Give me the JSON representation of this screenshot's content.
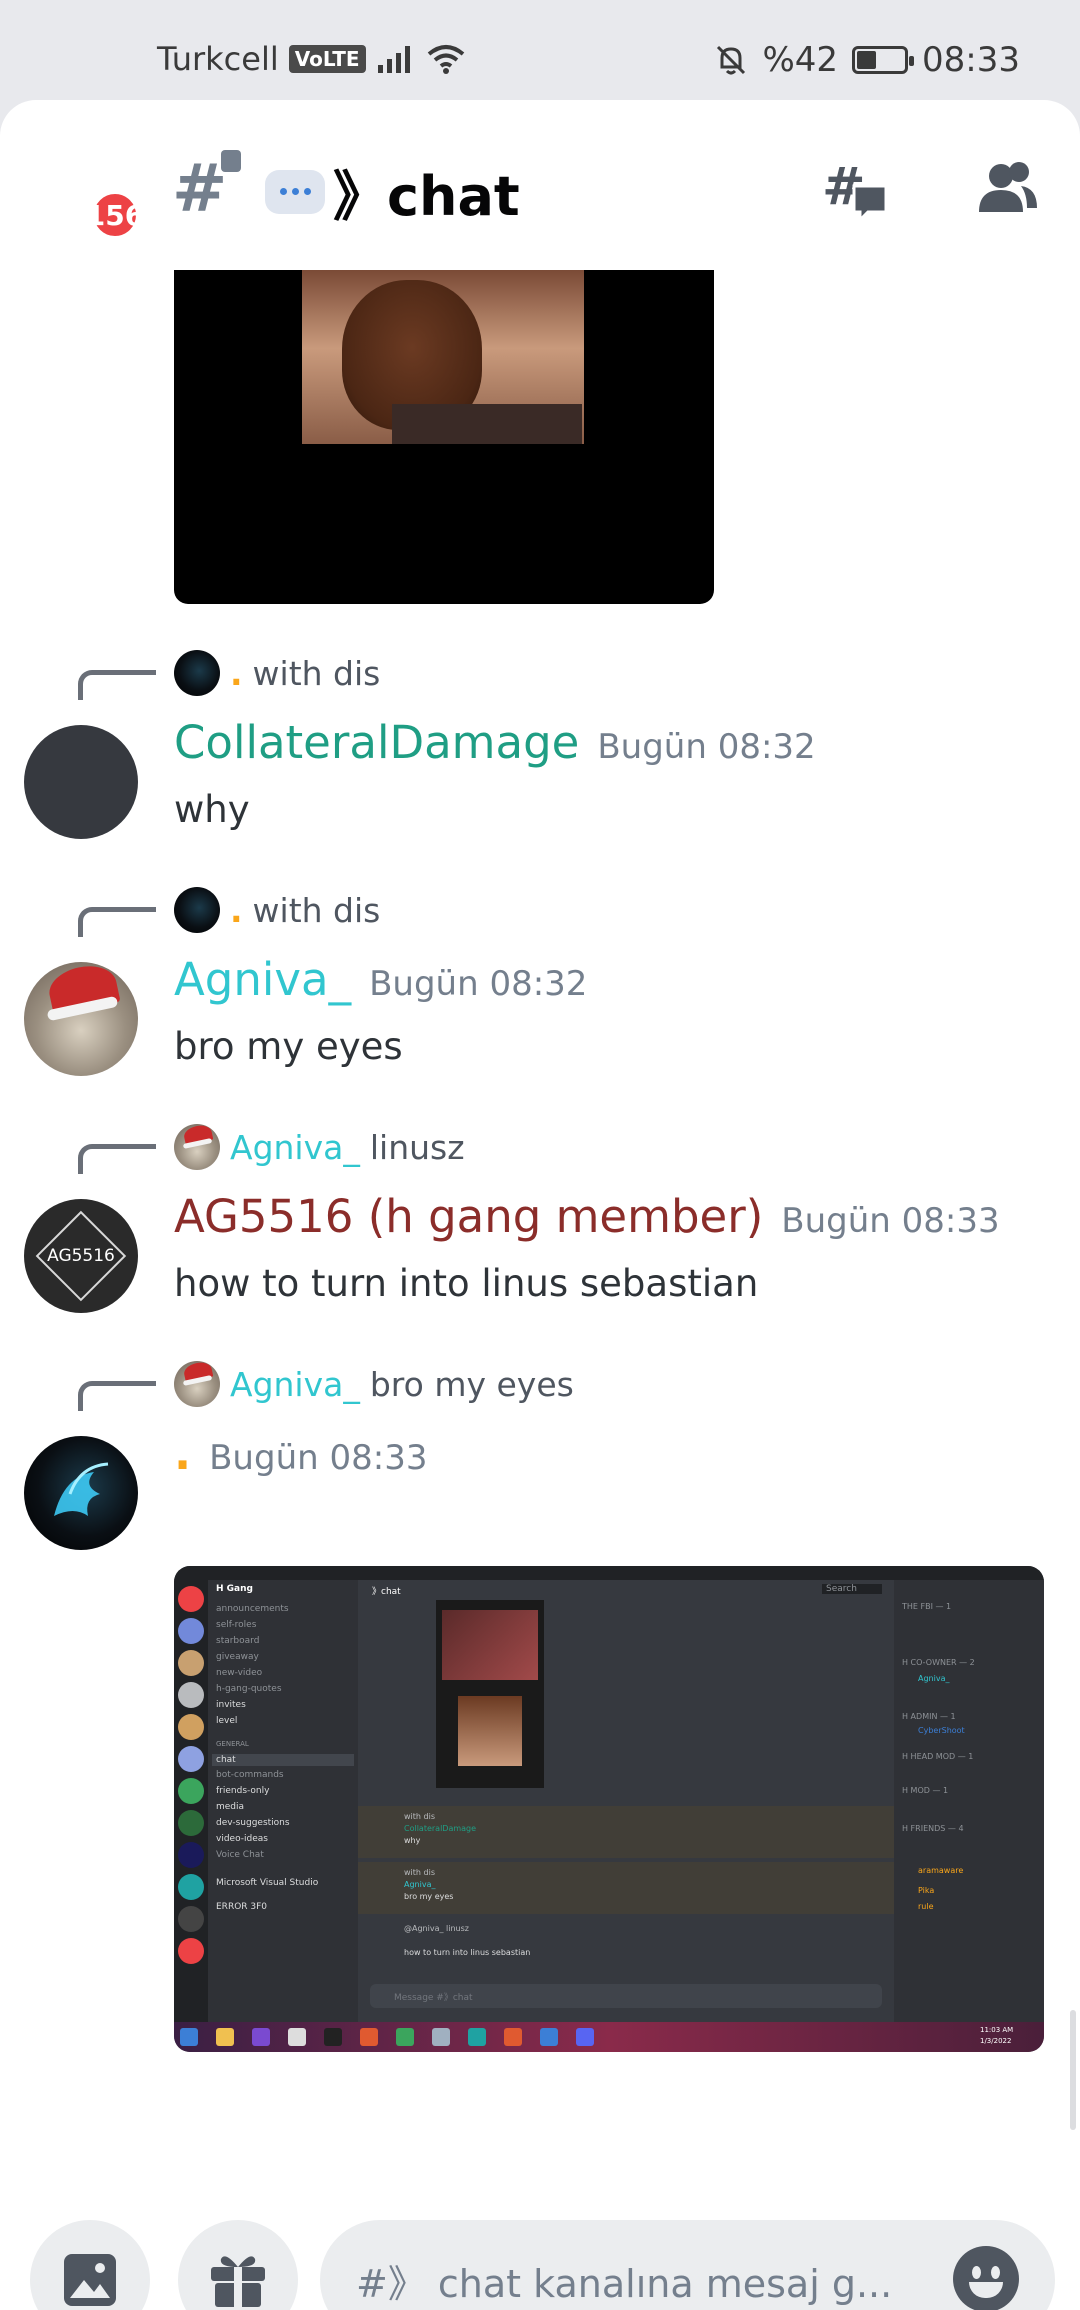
{
  "status_bar": {
    "carrier": "Turkcell",
    "volte": "VoLTE",
    "battery_text": "%42",
    "battery_level": 0.42,
    "time": "08:33"
  },
  "header": {
    "notification_count": "156",
    "channel_name": "》chat"
  },
  "messages": [
    {
      "reply_author": ".",
      "reply_text": "with dis",
      "author": "CollateralDamage",
      "author_color": "#1f9e84",
      "timestamp": "Bugün 08:32",
      "text": "why"
    },
    {
      "reply_author": ".",
      "reply_text": "with dis",
      "author": "Agniva_",
      "author_color": "#31c6cf",
      "timestamp": "Bugün 08:32",
      "text": "bro my eyes"
    },
    {
      "reply_author": "Agniva_",
      "reply_text": "linusz",
      "author": "AG5516 (h gang member)",
      "author_color": "#8b2d2a",
      "avatar_text": "AG5516",
      "timestamp": "Bugün 08:33",
      "text": "how to turn into linus sebastian"
    },
    {
      "reply_author": "Agniva_",
      "reply_text": "bro my eyes",
      "author": ".",
      "author_color": "#faa61a",
      "timestamp": "Bugün 08:33",
      "text": ""
    }
  ],
  "screenshot": {
    "server_name": "H Gang",
    "channels": [
      "announcements",
      "self-roles",
      "starboard",
      "giveaway",
      "new-video",
      "h-gang-quotes",
      "invites",
      "level"
    ],
    "category": "GENERAL",
    "channels_general": [
      "chat",
      "bot-commands",
      "friends-only",
      "media",
      "dev-suggestions",
      "video-ideas",
      "Voice Chat"
    ],
    "active_channel": "chat",
    "channel_header": "》chat",
    "search": "Search",
    "member_sections": [
      "THE FBI — 1",
      "H CO-OWNER — 2",
      "H ADMIN — 1",
      "H HEAD MOD — 1",
      "H MOD — 1",
      "H FRIENDS — 4"
    ],
    "members": [
      "Agniva_",
      "CyberShoot",
      "Pika",
      "rule",
      "aramaware"
    ],
    "chat_lines": [
      "with dis",
      "CollateralDamage",
      "why",
      "with dis",
      "Agniva_",
      "bro my eyes",
      "@Agniva_ linusz",
      "how to turn into linus sebastian"
    ],
    "message_placeholder": "Message #》chat",
    "user": "ERROR 3F0",
    "app_label": "Microsoft Visual Studio",
    "clock": "11:03 AM",
    "date": "1/3/2022"
  },
  "composer": {
    "placeholder": "#》 chat kanalına mesaj g..."
  },
  "colors": {
    "accent_red": "#ed4245",
    "muted": "#747f8d",
    "text": "#2e3338"
  },
  "icons": [
    "signal-icon",
    "wifi-icon",
    "mute-bell-icon",
    "battery-icon",
    "text-channel-lock-icon",
    "threads-icon",
    "members-icon",
    "image-icon",
    "gift-icon",
    "emoji-icon"
  ]
}
